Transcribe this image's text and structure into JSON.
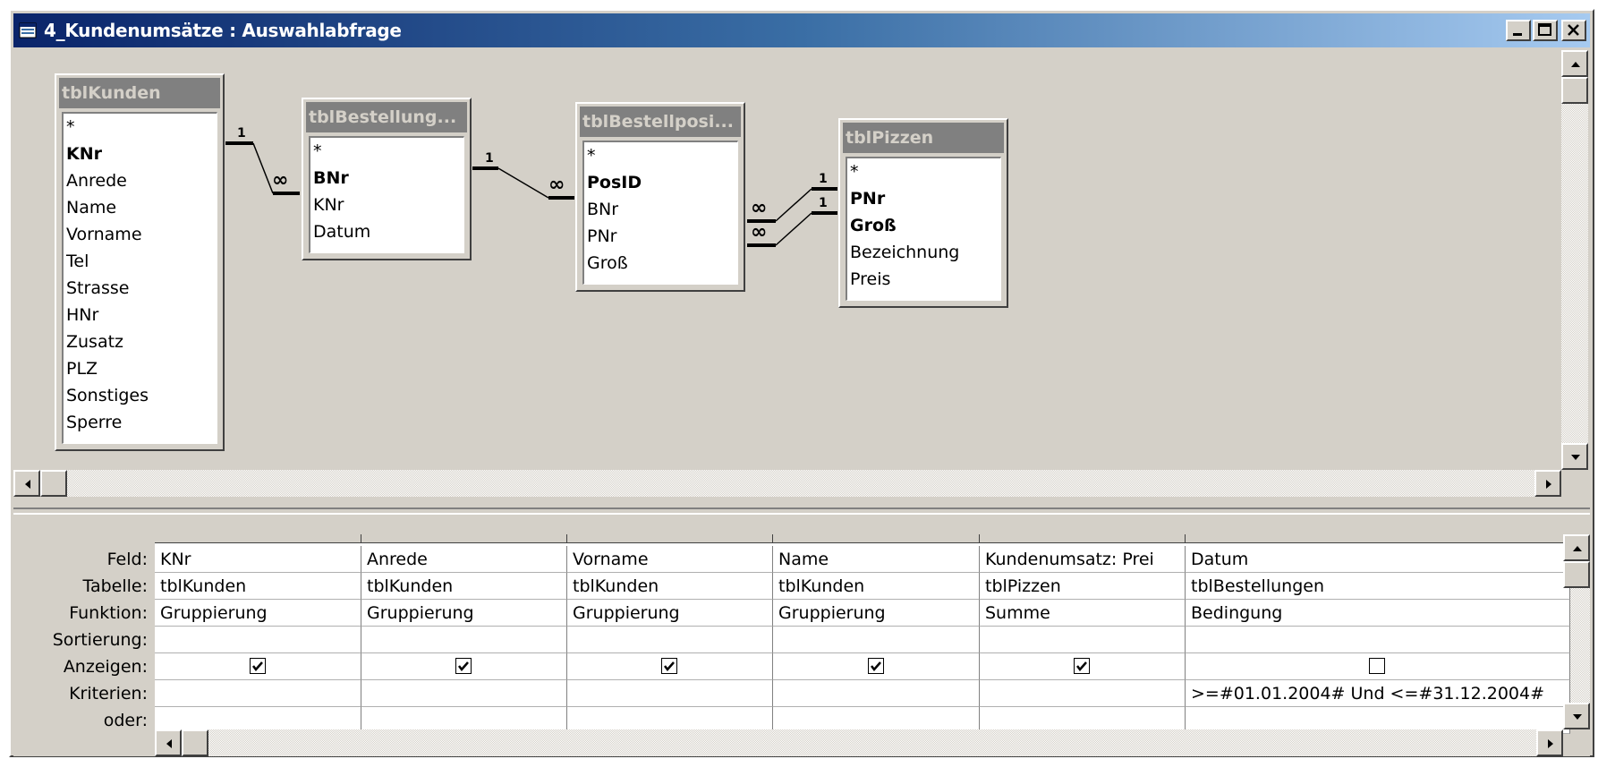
{
  "window": {
    "title": "4_Kundenumsätze : Auswahlabfrage",
    "buttons": [
      "minimize-icon",
      "maximize-icon",
      "close-icon"
    ]
  },
  "tables": [
    {
      "name": "tblKunden",
      "fields": [
        {
          "label": "*",
          "key": false
        },
        {
          "label": "KNr",
          "key": true
        },
        {
          "label": "Anrede",
          "key": false
        },
        {
          "label": "Name",
          "key": false
        },
        {
          "label": "Vorname",
          "key": false
        },
        {
          "label": "Tel",
          "key": false
        },
        {
          "label": "Strasse",
          "key": false
        },
        {
          "label": "HNr",
          "key": false
        },
        {
          "label": "Zusatz",
          "key": false
        },
        {
          "label": "PLZ",
          "key": false
        },
        {
          "label": "Sonstiges",
          "key": false
        },
        {
          "label": "Sperre",
          "key": false
        }
      ]
    },
    {
      "name": "tblBestellung...",
      "fields": [
        {
          "label": "*",
          "key": false
        },
        {
          "label": "BNr",
          "key": true
        },
        {
          "label": "KNr",
          "key": false
        },
        {
          "label": "Datum",
          "key": false
        }
      ]
    },
    {
      "name": "tblBestellposi...",
      "fields": [
        {
          "label": "*",
          "key": false
        },
        {
          "label": "PosID",
          "key": true
        },
        {
          "label": "BNr",
          "key": false
        },
        {
          "label": "PNr",
          "key": false
        },
        {
          "label": "Groß",
          "key": false
        }
      ]
    },
    {
      "name": "tblPizzen",
      "fields": [
        {
          "label": "*",
          "key": false
        },
        {
          "label": "PNr",
          "key": true
        },
        {
          "label": "Groß",
          "key": true
        },
        {
          "label": "Bezeichnung",
          "key": false
        },
        {
          "label": "Preis",
          "key": false
        }
      ]
    }
  ],
  "relations": {
    "one": "1",
    "many": "∞"
  },
  "grid": {
    "row_labels": [
      "Feld:",
      "Tabelle:",
      "Funktion:",
      "Sortierung:",
      "Anzeigen:",
      "Kriterien:",
      "oder:"
    ],
    "columns": [
      {
        "feld": "KNr",
        "tabelle": "tblKunden",
        "funktion": "Gruppierung",
        "sortierung": "",
        "anzeigen": true,
        "kriterien": "",
        "oder": ""
      },
      {
        "feld": "Anrede",
        "tabelle": "tblKunden",
        "funktion": "Gruppierung",
        "sortierung": "",
        "anzeigen": true,
        "kriterien": "",
        "oder": ""
      },
      {
        "feld": "Vorname",
        "tabelle": "tblKunden",
        "funktion": "Gruppierung",
        "sortierung": "",
        "anzeigen": true,
        "kriterien": "",
        "oder": ""
      },
      {
        "feld": "Name",
        "tabelle": "tblKunden",
        "funktion": "Gruppierung",
        "sortierung": "",
        "anzeigen": true,
        "kriterien": "",
        "oder": ""
      },
      {
        "feld": "Kundenumsatz: Prei",
        "tabelle": "tblPizzen",
        "funktion": "Summe",
        "sortierung": "",
        "anzeigen": true,
        "kriterien": "",
        "oder": ""
      },
      {
        "feld": "Datum",
        "tabelle": "tblBestellungen",
        "funktion": "Bedingung",
        "sortierung": "",
        "anzeigen": false,
        "kriterien": ">=#01.01.2004# Und <=#31.12.2004#",
        "oder": ""
      }
    ]
  }
}
